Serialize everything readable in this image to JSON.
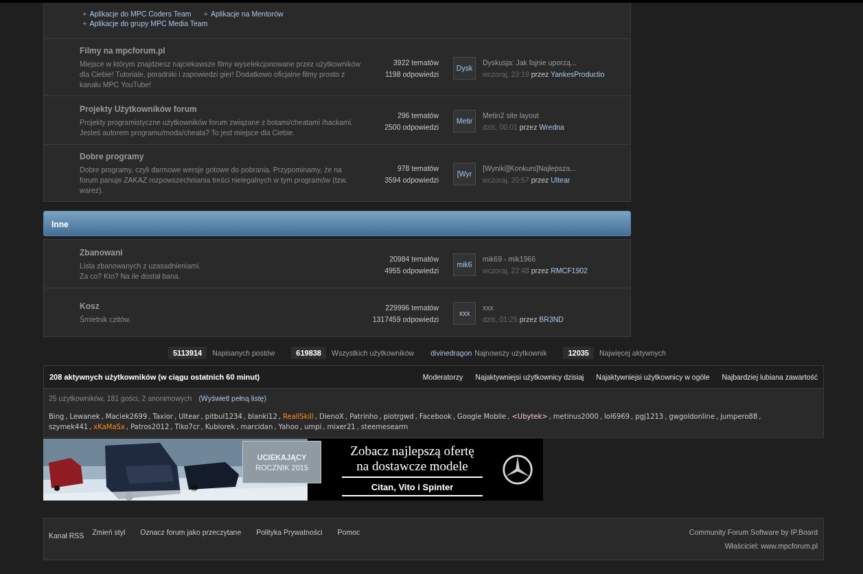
{
  "top_forum": {
    "bullet": "+",
    "subforums": [
      "Aplikacje do MPC Coders Team",
      "Aplikacje na Mentorów",
      "Aplikacje do grupy MPC Media Team"
    ]
  },
  "sections": [
    {
      "forums": [
        {
          "title": "Filmy na mpcforum.pl",
          "description": "Miejsce w którym znajdziesz najciekawsze filmy wyselekcjonowane przez użytkowników dla Ciebie! Tutoriale, poradniki i zapowiedzi gier! Dodatkowo oficjalne filmy prosto z kanału MPC YouTube!",
          "topics": "3922 tematów",
          "replies": "1198 odpowiedzi",
          "thumb": "Dysk",
          "last_title": "Dyskusja: Jak fajnie uporzą...",
          "last_time": "wczoraj, 23:19",
          "by": "przez",
          "last_user": "YankesProductio"
        },
        {
          "title": "Projekty Użytkowników forum",
          "description": "Projekty programistyczne użytkowników forum związane z botami/cheatami /hackami. Jesteś autorem programu/moda/cheata? To jest miejsce dla Ciebie.",
          "topics": "296 tematów",
          "replies": "2500 odpowiedzi",
          "thumb": "Metir",
          "last_title": "Metin2 site layout",
          "last_time": "dziś, 00:01",
          "by": "przez",
          "last_user": "Wredna"
        },
        {
          "title": "Dobre programy",
          "description": "Dobre programy, czyli darmowe wersje gotowe do pobrania. Przypominamy, że na forum panuje ZAKAZ rozpowszechniania treści nielegalnych w tym programów (tzw. warez).",
          "topics": "978 tematów",
          "replies": "3594 odpowiedzi",
          "thumb": "[Wyr",
          "last_title": "[Wyniki][Konkurs]Najlepsza...",
          "last_time": "wczoraj, 20:57",
          "by": "przez",
          "last_user": "Ultear"
        }
      ]
    },
    {
      "header": "Inne",
      "forums": [
        {
          "title": "Zbanowani",
          "description": "Lista zbanowanych z uzasadnieniami.\nZa co? Kto? Na ile dostał bana.",
          "topics": "20984 tematów",
          "replies": "4955 odpowiedzi",
          "thumb": "mik6",
          "last_title": "mik69 - mik1966",
          "last_time": "wczoraj, 22:48",
          "by": "przez",
          "last_user": "RMCF1902"
        },
        {
          "title": "Kosz",
          "description": "Śmietnik czitów.",
          "topics": "229996 tematów",
          "replies": "1317459 odpowiedzi",
          "thumb": "xxx",
          "last_title": "xxx",
          "last_time": "dziś, 01:25",
          "by": "przez",
          "last_user": "BR3ND"
        }
      ]
    }
  ],
  "stats": [
    {
      "kind": "count",
      "value": "5113914",
      "label": "Napisanych postów"
    },
    {
      "kind": "count",
      "value": "619838",
      "label": "Wszystkich użytkowników"
    },
    {
      "kind": "newest",
      "value": "divinedragon",
      "label": "Najnowszy użytkownik"
    },
    {
      "kind": "count",
      "value": "12035",
      "label": "Najwięcej aktywnych"
    }
  ],
  "online": {
    "title": "208 aktywnych użytkowników (w ciągu ostatnich 60 minut)",
    "links": [
      "Moderatorzy",
      "Najaktywniejsi użytkownicy dzisiaj",
      "Najaktywniejsi użytkownicy w ogóle",
      "Najbardziej lubiana zawartość"
    ],
    "summary": "25 użytkowników, 181 gości, 2 anonimowych",
    "full_list": "(Wyświetl pełną listę)",
    "separator": ",",
    "users": [
      {
        "name": "Bing",
        "color": "#c8c8c8"
      },
      {
        "name": "Lewanek",
        "color": "#c8c8c8"
      },
      {
        "name": "Maciek2699",
        "color": "#c8c8c8"
      },
      {
        "name": "Taxior",
        "color": "#c8c8c8"
      },
      {
        "name": "Ultear",
        "color": "#c8c8c8"
      },
      {
        "name": "pitbul1234",
        "color": "#c8c8c8"
      },
      {
        "name": "blanki12",
        "color": "#c8c8c8"
      },
      {
        "name": "ReallSkill",
        "color": "#ff8c1a"
      },
      {
        "name": "DienoX",
        "color": "#c8c8c8"
      },
      {
        "name": "Patrinho",
        "color": "#c8c8c8"
      },
      {
        "name": "piotrgwd",
        "color": "#c8c8c8"
      },
      {
        "name": "Facebook",
        "color": "#c8c8c8"
      },
      {
        "name": "Google Mobile",
        "color": "#c8c8c8"
      },
      {
        "name": "<Ubytek>",
        "color": "#f0c8c8"
      },
      {
        "name": "metinus2000",
        "color": "#c8c8c8"
      },
      {
        "name": "lol6969",
        "color": "#c8c8c8"
      },
      {
        "name": "pgj1213",
        "color": "#c8c8c8"
      },
      {
        "name": "gwgoldonline",
        "color": "#c8c8c8"
      },
      {
        "name": "jumpero88",
        "color": "#c8c8c8"
      },
      {
        "name": "szymek441",
        "color": "#c8c8c8"
      },
      {
        "name": "xKaMaSx",
        "color": "#ff8c1a"
      },
      {
        "name": "Patros2012",
        "color": "#c8c8c8"
      },
      {
        "name": "Tiko7cr",
        "color": "#c8c8c8"
      },
      {
        "name": "Kubiorek",
        "color": "#c8c8c8"
      },
      {
        "name": "marcidan",
        "color": "#c8c8c8"
      },
      {
        "name": "Yahoo",
        "color": "#c8c8c8"
      },
      {
        "name": "umpi",
        "color": "#c8c8c8"
      },
      {
        "name": "mixer21",
        "color": "#c8c8c8"
      },
      {
        "name": "steemesearm",
        "color": "#c8c8c8"
      }
    ]
  },
  "banner": {
    "kind": "picture",
    "badge": [
      "UCIEKAJĄCY",
      "ROCZNIK 2015"
    ],
    "headline": [
      "Zobacz najlepszą ofertę",
      "na dostawcze modele"
    ],
    "models": "Citan, Vito i Spinter"
  },
  "footer": {
    "links": [
      "Kanał RSS",
      "Zmień styl",
      "Oznacz forum jako przeczytane",
      "Polityka Prywatności",
      "Pomoc"
    ],
    "credit": "Community Forum Software by IP.Board",
    "owner": "Właściciel: www.mpcforum.pl"
  }
}
